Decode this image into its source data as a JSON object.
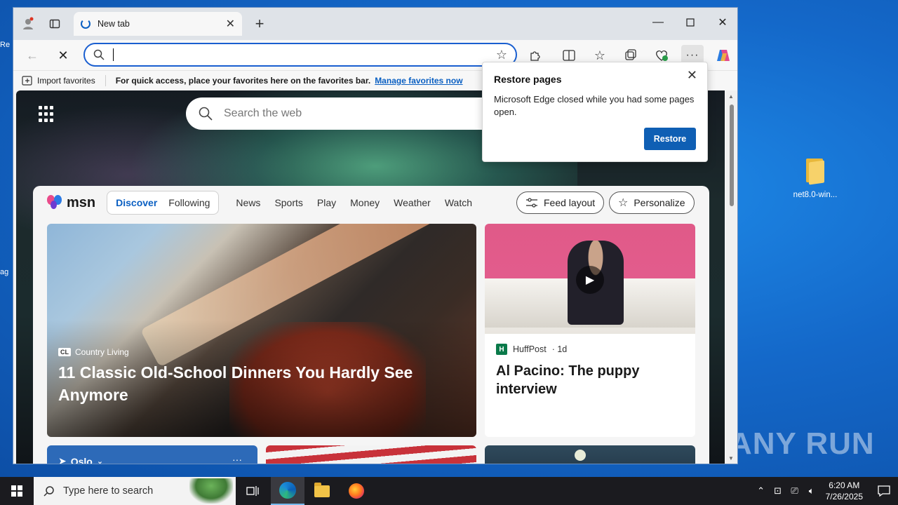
{
  "desktop": {
    "icon_label": "net8.0-win...",
    "watermark": "ANY RUN",
    "left_fragments": [
      "Re",
      "ag"
    ]
  },
  "browser": {
    "tab_title": "New tab",
    "address_value": "",
    "favbar": {
      "import_label": "Import favorites",
      "hint": "For quick access, place your favorites here on the favorites bar.",
      "manage_link": "Manage favorites now"
    },
    "page": {
      "search_placeholder": "Search the web",
      "msn_logo": "msn",
      "segments": [
        "Discover",
        "Following"
      ],
      "nav_links": [
        "News",
        "Sports",
        "Play",
        "Money",
        "Weather",
        "Watch"
      ],
      "feed_layout": "Feed layout",
      "personalize": "Personalize",
      "hero": {
        "source_badge": "CL",
        "source": "Country Living",
        "headline": "11 Classic Old-School Dinners You Hardly See Anymore"
      },
      "card2": {
        "source_badge": "H",
        "source": "HuffPost",
        "age": "· 1d",
        "headline": "Al Pacino: The puppy interview"
      },
      "weather": {
        "location": "Oslo",
        "more": "···"
      }
    },
    "popup": {
      "title": "Restore pages",
      "message": "Microsoft Edge closed while you had some pages open.",
      "button": "Restore"
    }
  },
  "taskbar": {
    "search_placeholder": "Type here to search",
    "time": "6:20 AM",
    "date": "7/26/2025"
  },
  "colors": {
    "accent": "#0f5fb4",
    "desktop": "#1468c9",
    "taskbar": "#1b1b1f"
  }
}
